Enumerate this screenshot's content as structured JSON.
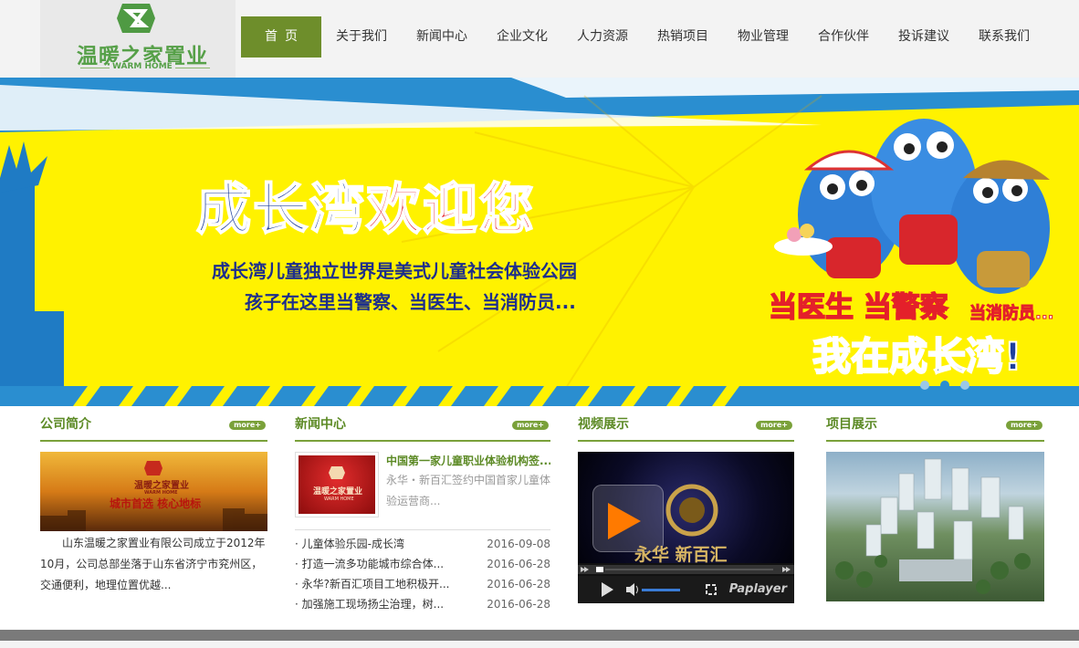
{
  "brand": {
    "name_cn": "温暖之家置业",
    "name_en": "WARM HOME"
  },
  "nav": {
    "items": [
      {
        "label": "首页",
        "active": true
      },
      {
        "label": "关于我们"
      },
      {
        "label": "新闻中心"
      },
      {
        "label": "企业文化"
      },
      {
        "label": "人力资源"
      },
      {
        "label": "热销项目"
      },
      {
        "label": "物业管理"
      },
      {
        "label": "合作伙伴"
      },
      {
        "label": "投诉建议"
      },
      {
        "label": "联系我们"
      }
    ]
  },
  "banner": {
    "headline_blue": "成长湾",
    "headline_red": "欢迎您",
    "line1": "成长湾儿童独立世界是美式儿童社会体验公园",
    "line2": "孩子在这里当警察、当医生、当消防员...",
    "right_1": "当医生 当警察",
    "right_1b": "当消防员...",
    "right_2_red": "我在",
    "right_2_blue": "成长湾!",
    "slides": 3,
    "active_slide": 1
  },
  "sections": {
    "more_label": "more+",
    "about": {
      "title": "公司简介",
      "image_logo": "温暖之家置业",
      "image_logo_en": "WARM HOME",
      "image_slogan": "城市首选 核心地标",
      "desc": "山东温暖之家置业有限公司成立于2012年10月，公司总部坐落于山东省济宁市兖州区，交通便利，地理位置优越..."
    },
    "news": {
      "title": "新闻中心",
      "thumb_logo": "温暖之家置业",
      "thumb_logo_en": "WARM HOME",
      "featured_title": "中国第一家儿童职业体验机构签...",
      "featured_desc": "永华・新百汇签约中国首家儿童体验运营商...",
      "items": [
        {
          "title": "· 儿童体验乐园-成长湾",
          "date": "2016-09-08"
        },
        {
          "title": "· 打造一流多功能城市综合体...",
          "date": "2016-06-28"
        },
        {
          "title": "· 永华?新百汇项目工地积极开...",
          "date": "2016-06-28"
        },
        {
          "title": "· 加强施工现场扬尘治理，树...",
          "date": "2016-06-28"
        }
      ]
    },
    "video": {
      "title": "视频展示",
      "overlay_text": "永华 新百汇",
      "player_label": "Paplayer"
    },
    "projects": {
      "title": "项目展示"
    }
  },
  "colors": {
    "brand_green": "#6e8e2b",
    "title_green": "#5c8a25",
    "banner_yellow": "#fff200",
    "banner_blue": "#1e3f9c",
    "banner_red": "#e4202a"
  }
}
